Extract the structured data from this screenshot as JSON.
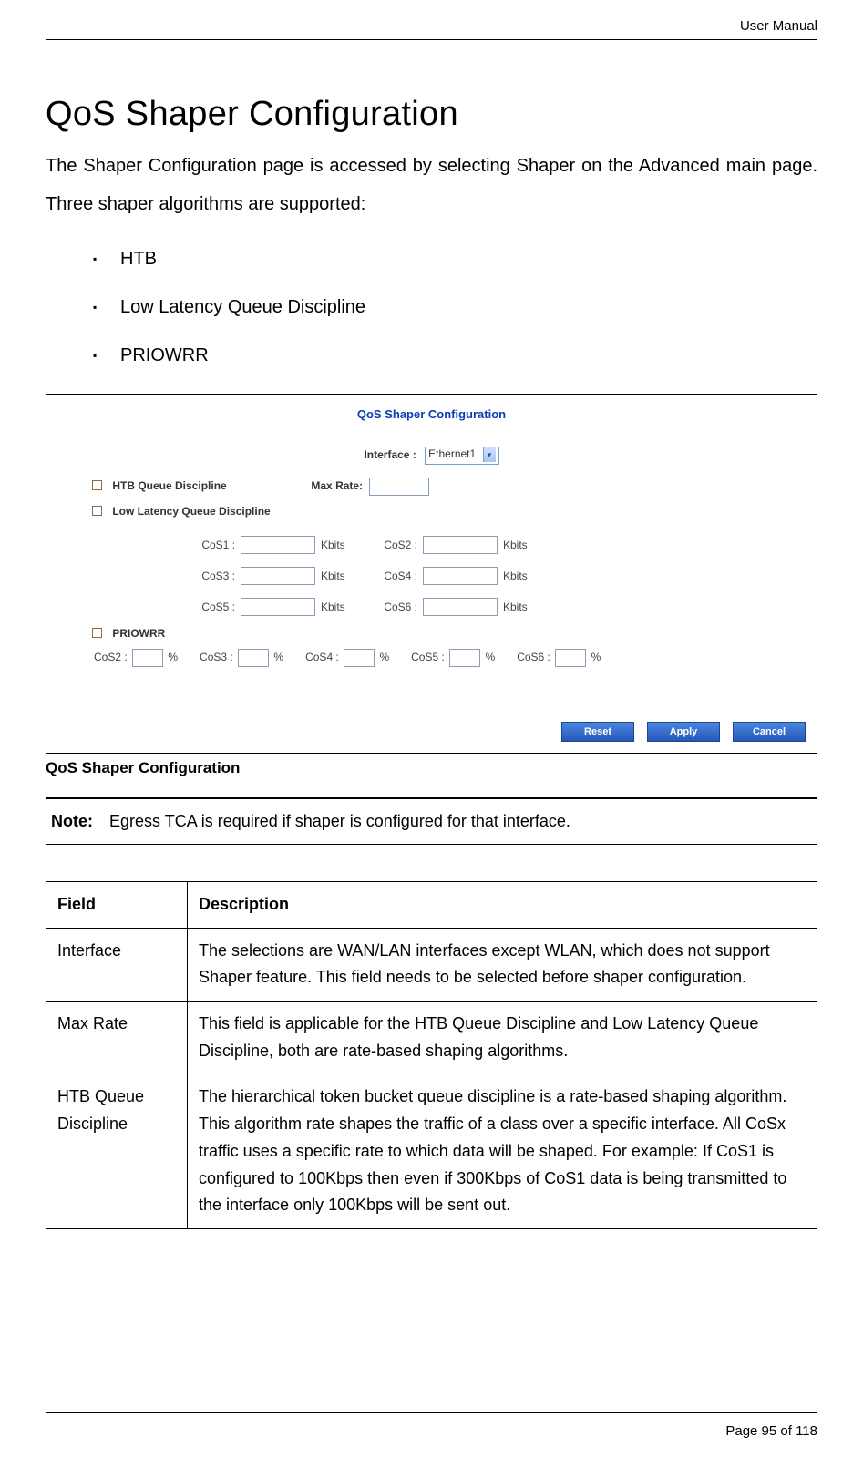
{
  "header_right": "User Manual",
  "title": "QoS Shaper Configuration",
  "intro": "The Shaper Configuration page is accessed by selecting Shaper on the Advanced main page. Three shaper algorithms are supported:",
  "bullets": [
    "HTB",
    "Low Latency Queue Discipline",
    "PRIOWRR"
  ],
  "ui": {
    "title": "QoS Shaper Configuration",
    "interface_label": "Interface :",
    "interface_value": "Ethernet1",
    "htb_label": "HTB Queue Discipline",
    "maxrate_label": "Max Rate:",
    "ll_label": "Low Latency Queue Discipline",
    "cos_unit": "Kbits",
    "cos1": "CoS1 :",
    "cos2": "CoS2 :",
    "cos3": "CoS3 :",
    "cos4": "CoS4 :",
    "cos5": "CoS5 :",
    "cos6": "CoS6 :",
    "priowrr_label": "PRIOWRR",
    "pct": "%",
    "reset": "Reset",
    "apply": "Apply",
    "cancel": "Cancel"
  },
  "figcaption": "QoS Shaper Configuration",
  "note_label": "Note:",
  "note_text": "Egress TCA is required if shaper is configured for that interface.",
  "table": {
    "head_field": "Field",
    "head_desc": "Description",
    "rows": [
      {
        "field": "Interface",
        "desc": "The selections are WAN/LAN interfaces except WLAN, which does not support Shaper feature. This field needs to be selected before shaper configuration."
      },
      {
        "field": "Max Rate",
        "desc": "This field is applicable for the HTB Queue Discipline and Low Latency Queue Discipline, both are rate-based shaping algorithms."
      },
      {
        "field": "HTB Queue Discipline",
        "desc": "The hierarchical token bucket queue discipline is a rate-based shaping algorithm. This algorithm rate shapes the traffic of a class over a specific interface. All CoSx traffic uses a specific rate to which data will be shaped. For example: If CoS1 is configured to 100Kbps then even if 300Kbps of CoS1 data is being transmitted to the interface only 100Kbps will be sent out."
      }
    ]
  },
  "footer": "Page 95 of 118"
}
